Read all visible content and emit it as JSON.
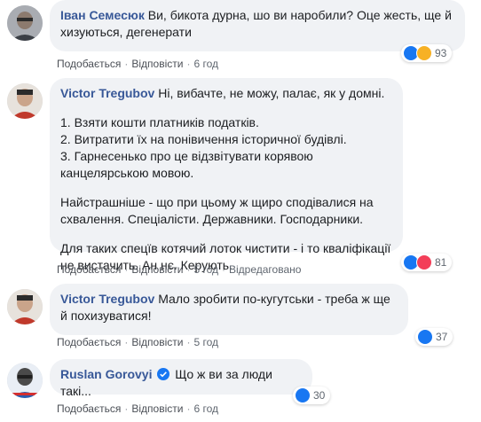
{
  "colors": {
    "bubble_bg": "#f0f2f5",
    "author": "#385898",
    "action_text": "#606770",
    "like": "#1877f2",
    "love": "#f33e58",
    "sad": "#f7b125"
  },
  "comments": [
    {
      "author": "Іван Семесюк",
      "text": "Ви, бикота дурна, шо ви наробили? Оце жесть, ще й хизуються, дегенерати",
      "like_label": "Подобається",
      "reply_label": "Відповісти",
      "time": "6 год",
      "reaction_count": "93",
      "reaction_icons": [
        "like-icon",
        "sad-icon"
      ]
    },
    {
      "author": "Victor Tregubov",
      "lines": [
        "Ні, вибачте, не можу, палає, як у домні.",
        "1. Взяти кошти платників податків.",
        "2. Витратити їх на понівичення історичної будівлі.",
        "3. Гарнесенько про це відзвітувати корявою канцелярською мовою.",
        "Найстрашніше - що при цьому ж щиро сподівалися на схвалення. Спеціалісти. Державники. Господарники.",
        "Для таких спецїв котячий лоток чистити - і то кваліфікації не вистачить. Ан нє. Керують."
      ],
      "like_label": "Подобається",
      "reply_label": "Відповісти",
      "time": "5 год",
      "edited_label": "Відредаговано",
      "reaction_count": "81",
      "reaction_icons": [
        "like-icon",
        "love-icon"
      ]
    },
    {
      "author": "Victor Tregubov",
      "text": "Мало зробити по-кугутськи - треба ж ще й похизуватися!",
      "like_label": "Подобається",
      "reply_label": "Відповісти",
      "time": "5 год",
      "reaction_count": "37",
      "reaction_icons": [
        "like-icon"
      ]
    },
    {
      "author": "Ruslan Gorovyi",
      "text": "Що ж ви за люди такі...",
      "like_label": "Подобається",
      "reply_label": "Відповісти",
      "time": "6 год",
      "reaction_count": "30",
      "reaction_icons": [
        "like-icon"
      ]
    }
  ]
}
